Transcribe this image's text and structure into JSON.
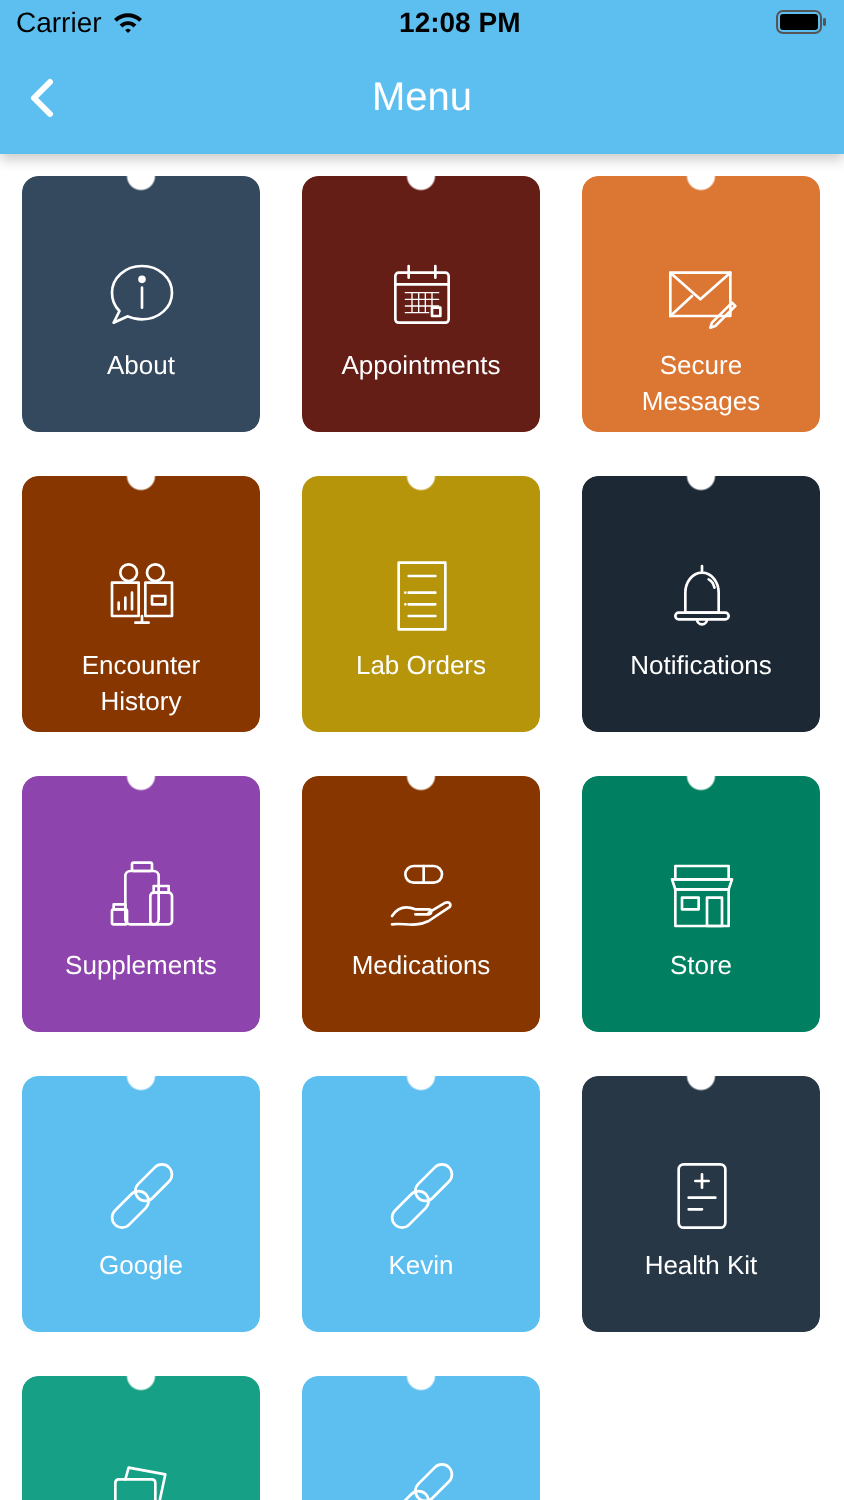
{
  "status_bar": {
    "carrier": "Carrier",
    "time": "12:08 PM"
  },
  "nav_bar": {
    "title": "Menu"
  },
  "tiles": [
    {
      "label": "About",
      "kind": "info",
      "color": "#34495e"
    },
    {
      "label": "Appointments",
      "kind": "calendar",
      "color": "#641e16"
    },
    {
      "label": "Secure Messages",
      "kind": "envelope",
      "color": "#dc7633"
    },
    {
      "label": "Encounter History",
      "kind": "people",
      "color": "#873600"
    },
    {
      "label": "Lab Orders",
      "kind": "document",
      "color": "#b7950b"
    },
    {
      "label": "Notifications",
      "kind": "bell",
      "color": "#1c2833"
    },
    {
      "label": "Supplements",
      "kind": "bottles",
      "color": "#8e44ad"
    },
    {
      "label": "Medications",
      "kind": "pill",
      "color": "#873600"
    },
    {
      "label": "Store",
      "kind": "store",
      "color": "#008060"
    },
    {
      "label": "Google",
      "kind": "link",
      "color": "#5dbfef"
    },
    {
      "label": "Kevin",
      "kind": "link",
      "color": "#5dbfef"
    },
    {
      "label": "Health Kit",
      "kind": "report",
      "color": "#273746"
    },
    {
      "kind": "cards",
      "color": "#16a085"
    },
    {
      "kind": "link",
      "color": "#5dbfef"
    }
  ]
}
